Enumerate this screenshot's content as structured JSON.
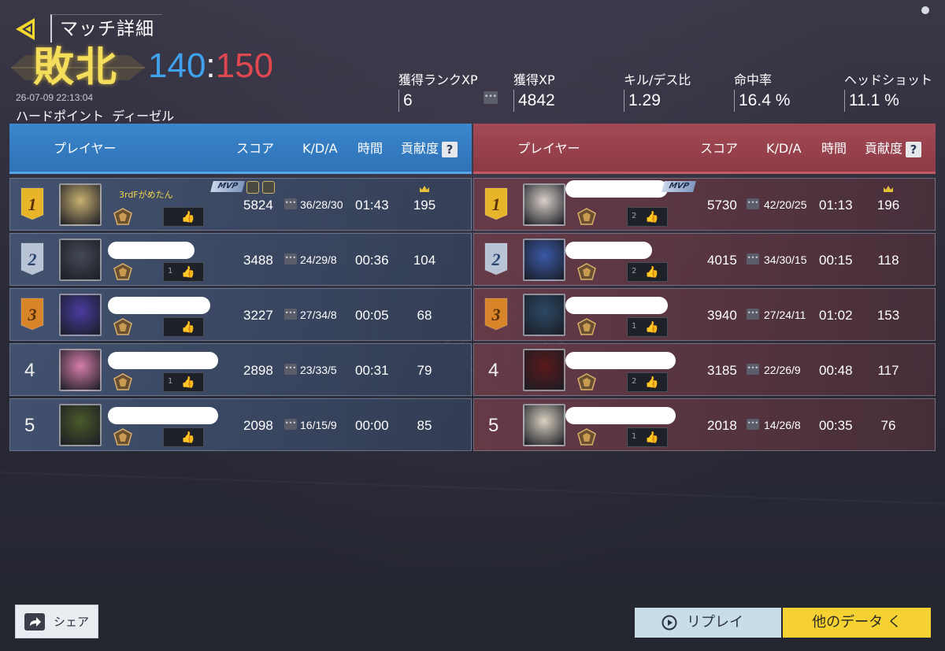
{
  "header": {
    "title": "マッチ詳細",
    "result": "敗北",
    "score_blue": "140",
    "score_sep": ":",
    "score_red": "150",
    "datetime": "26-07-09 22:13:04",
    "mode": "ハードポイント",
    "map": "ディーゼル"
  },
  "stats": [
    {
      "label": "獲得ランクXP",
      "value": "6"
    },
    {
      "label": "獲得XP",
      "value": "4842"
    },
    {
      "label": "キル/デス比",
      "value": "1.29"
    },
    {
      "label": "命中率",
      "value": "16.4 %"
    },
    {
      "label": "ヘッドショット",
      "value": "11.1 %"
    }
  ],
  "columns": {
    "player": "プレイヤー",
    "score": "スコア",
    "kda": "K/D/A",
    "time": "時間",
    "contrib": "貢献度",
    "help": "?"
  },
  "blue_team": [
    {
      "rank": "1",
      "name": "3rdFがめたん",
      "likes": "",
      "score": "5824",
      "kda": "36/28/30",
      "time": "01:43",
      "contrib": "195",
      "mvp": "MVP"
    },
    {
      "rank": "2",
      "name": "",
      "likes": "1",
      "score": "3488",
      "kda": "24/29/8",
      "time": "00:36",
      "contrib": "104"
    },
    {
      "rank": "3",
      "name": "",
      "likes": "",
      "score": "3227",
      "kda": "27/34/8",
      "time": "00:05",
      "contrib": "68"
    },
    {
      "rank": "4",
      "name": "",
      "likes": "1",
      "score": "2898",
      "kda": "23/33/5",
      "time": "00:31",
      "contrib": "79"
    },
    {
      "rank": "5",
      "name": "",
      "likes": "",
      "score": "2098",
      "kda": "16/15/9",
      "time": "00:00",
      "contrib": "85"
    }
  ],
  "red_team": [
    {
      "rank": "1",
      "name": "",
      "likes": "2",
      "score": "5730",
      "kda": "42/20/25",
      "time": "01:13",
      "contrib": "196",
      "mvp": "MVP"
    },
    {
      "rank": "2",
      "name": "",
      "likes": "2",
      "score": "4015",
      "kda": "34/30/15",
      "time": "00:15",
      "contrib": "118"
    },
    {
      "rank": "3",
      "name": "",
      "likes": "1",
      "score": "3940",
      "kda": "27/24/11",
      "time": "01:02",
      "contrib": "153"
    },
    {
      "rank": "4",
      "name": "",
      "likes": "2",
      "score": "3185",
      "kda": "22/26/9",
      "time": "00:48",
      "contrib": "117"
    },
    {
      "rank": "5",
      "name": "",
      "likes": "1",
      "score": "2018",
      "kda": "14/26/8",
      "time": "00:35",
      "contrib": "76"
    }
  ],
  "buttons": {
    "share": "シェア",
    "replay": "リプレイ",
    "more": "他のデータ く"
  },
  "icons": {
    "back": "back-arrow-icon",
    "more_dots": "ellipsis-icon",
    "like": "thumbs-up-icon",
    "share": "share-icon",
    "replay": "play-circle-icon",
    "help": "question-icon",
    "crown": "crown-icon"
  },
  "colors": {
    "blue_team": "#3a86cc",
    "red_team": "#a34a55",
    "result_gold": "#f3dd5b",
    "score_blue": "#3fa2ef",
    "score_red": "#e0474e",
    "accent_yellow": "#f5d232"
  }
}
